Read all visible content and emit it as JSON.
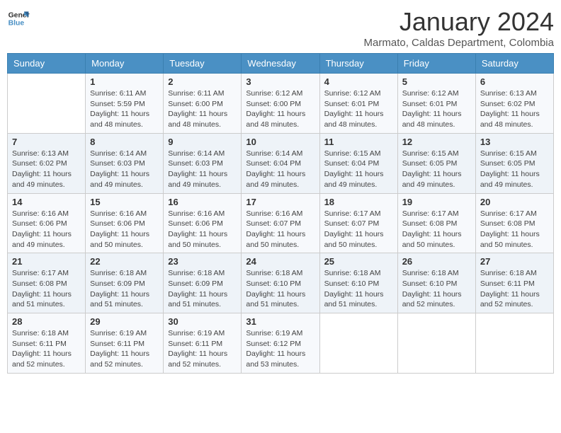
{
  "header": {
    "logo_line1": "General",
    "logo_line2": "Blue",
    "month": "January 2024",
    "location": "Marmato, Caldas Department, Colombia"
  },
  "weekdays": [
    "Sunday",
    "Monday",
    "Tuesday",
    "Wednesday",
    "Thursday",
    "Friday",
    "Saturday"
  ],
  "weeks": [
    [
      {
        "day": "",
        "info": ""
      },
      {
        "day": "1",
        "info": "Sunrise: 6:11 AM\nSunset: 5:59 PM\nDaylight: 11 hours\nand 48 minutes."
      },
      {
        "day": "2",
        "info": "Sunrise: 6:11 AM\nSunset: 6:00 PM\nDaylight: 11 hours\nand 48 minutes."
      },
      {
        "day": "3",
        "info": "Sunrise: 6:12 AM\nSunset: 6:00 PM\nDaylight: 11 hours\nand 48 minutes."
      },
      {
        "day": "4",
        "info": "Sunrise: 6:12 AM\nSunset: 6:01 PM\nDaylight: 11 hours\nand 48 minutes."
      },
      {
        "day": "5",
        "info": "Sunrise: 6:12 AM\nSunset: 6:01 PM\nDaylight: 11 hours\nand 48 minutes."
      },
      {
        "day": "6",
        "info": "Sunrise: 6:13 AM\nSunset: 6:02 PM\nDaylight: 11 hours\nand 48 minutes."
      }
    ],
    [
      {
        "day": "7",
        "info": "Sunrise: 6:13 AM\nSunset: 6:02 PM\nDaylight: 11 hours\nand 49 minutes."
      },
      {
        "day": "8",
        "info": "Sunrise: 6:14 AM\nSunset: 6:03 PM\nDaylight: 11 hours\nand 49 minutes."
      },
      {
        "day": "9",
        "info": "Sunrise: 6:14 AM\nSunset: 6:03 PM\nDaylight: 11 hours\nand 49 minutes."
      },
      {
        "day": "10",
        "info": "Sunrise: 6:14 AM\nSunset: 6:04 PM\nDaylight: 11 hours\nand 49 minutes."
      },
      {
        "day": "11",
        "info": "Sunrise: 6:15 AM\nSunset: 6:04 PM\nDaylight: 11 hours\nand 49 minutes."
      },
      {
        "day": "12",
        "info": "Sunrise: 6:15 AM\nSunset: 6:05 PM\nDaylight: 11 hours\nand 49 minutes."
      },
      {
        "day": "13",
        "info": "Sunrise: 6:15 AM\nSunset: 6:05 PM\nDaylight: 11 hours\nand 49 minutes."
      }
    ],
    [
      {
        "day": "14",
        "info": "Sunrise: 6:16 AM\nSunset: 6:06 PM\nDaylight: 11 hours\nand 49 minutes."
      },
      {
        "day": "15",
        "info": "Sunrise: 6:16 AM\nSunset: 6:06 PM\nDaylight: 11 hours\nand 50 minutes."
      },
      {
        "day": "16",
        "info": "Sunrise: 6:16 AM\nSunset: 6:06 PM\nDaylight: 11 hours\nand 50 minutes."
      },
      {
        "day": "17",
        "info": "Sunrise: 6:16 AM\nSunset: 6:07 PM\nDaylight: 11 hours\nand 50 minutes."
      },
      {
        "day": "18",
        "info": "Sunrise: 6:17 AM\nSunset: 6:07 PM\nDaylight: 11 hours\nand 50 minutes."
      },
      {
        "day": "19",
        "info": "Sunrise: 6:17 AM\nSunset: 6:08 PM\nDaylight: 11 hours\nand 50 minutes."
      },
      {
        "day": "20",
        "info": "Sunrise: 6:17 AM\nSunset: 6:08 PM\nDaylight: 11 hours\nand 50 minutes."
      }
    ],
    [
      {
        "day": "21",
        "info": "Sunrise: 6:17 AM\nSunset: 6:08 PM\nDaylight: 11 hours\nand 51 minutes."
      },
      {
        "day": "22",
        "info": "Sunrise: 6:18 AM\nSunset: 6:09 PM\nDaylight: 11 hours\nand 51 minutes."
      },
      {
        "day": "23",
        "info": "Sunrise: 6:18 AM\nSunset: 6:09 PM\nDaylight: 11 hours\nand 51 minutes."
      },
      {
        "day": "24",
        "info": "Sunrise: 6:18 AM\nSunset: 6:10 PM\nDaylight: 11 hours\nand 51 minutes."
      },
      {
        "day": "25",
        "info": "Sunrise: 6:18 AM\nSunset: 6:10 PM\nDaylight: 11 hours\nand 51 minutes."
      },
      {
        "day": "26",
        "info": "Sunrise: 6:18 AM\nSunset: 6:10 PM\nDaylight: 11 hours\nand 52 minutes."
      },
      {
        "day": "27",
        "info": "Sunrise: 6:18 AM\nSunset: 6:11 PM\nDaylight: 11 hours\nand 52 minutes."
      }
    ],
    [
      {
        "day": "28",
        "info": "Sunrise: 6:18 AM\nSunset: 6:11 PM\nDaylight: 11 hours\nand 52 minutes."
      },
      {
        "day": "29",
        "info": "Sunrise: 6:19 AM\nSunset: 6:11 PM\nDaylight: 11 hours\nand 52 minutes."
      },
      {
        "day": "30",
        "info": "Sunrise: 6:19 AM\nSunset: 6:11 PM\nDaylight: 11 hours\nand 52 minutes."
      },
      {
        "day": "31",
        "info": "Sunrise: 6:19 AM\nSunset: 6:12 PM\nDaylight: 11 hours\nand 53 minutes."
      },
      {
        "day": "",
        "info": ""
      },
      {
        "day": "",
        "info": ""
      },
      {
        "day": "",
        "info": ""
      }
    ]
  ]
}
